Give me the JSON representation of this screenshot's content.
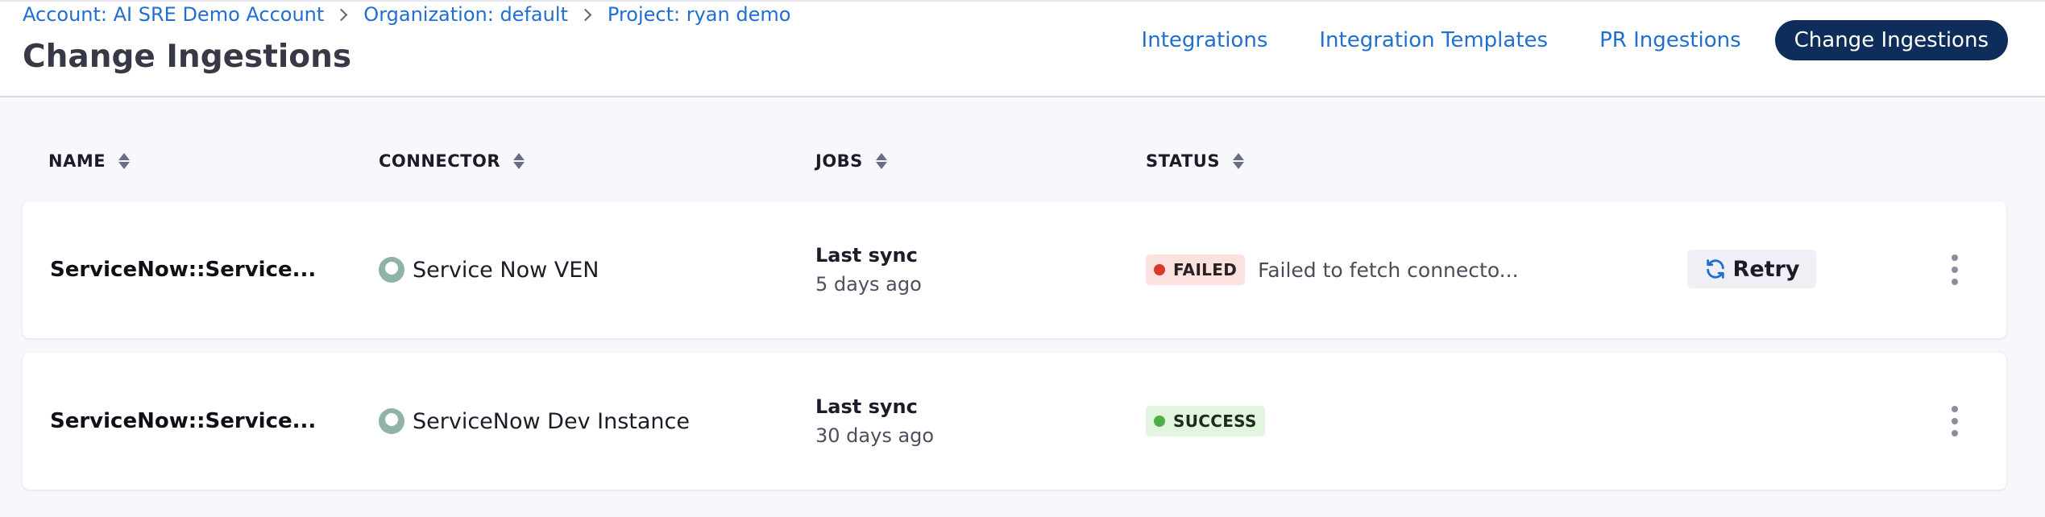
{
  "breadcrumb": [
    {
      "label": "Account: AI SRE Demo Account"
    },
    {
      "label": "Organization: default"
    },
    {
      "label": "Project: ryan demo"
    }
  ],
  "page_title": "Change Ingestions",
  "nav_tabs": [
    {
      "label": "Integrations",
      "active": false
    },
    {
      "label": "Integration Templates",
      "active": false
    },
    {
      "label": "PR Ingestions",
      "active": false
    },
    {
      "label": "Change Ingestions",
      "active": true
    }
  ],
  "table": {
    "columns": [
      "NAME",
      "CONNECTOR",
      "JOBS",
      "STATUS"
    ],
    "rows": [
      {
        "name": "ServiceNow::Service...",
        "connector": "Service Now VEN",
        "connector_icon": "connector-icon",
        "jobs_label": "Last sync",
        "jobs_time": "5 days ago",
        "status": "FAILED",
        "status_message": "Failed to fetch connecto...",
        "action_label": "Retry"
      },
      {
        "name": "ServiceNow::Service...",
        "connector": "ServiceNow Dev Instance",
        "connector_icon": "connector-icon",
        "jobs_label": "Last sync",
        "jobs_time": "30 days ago",
        "status": "SUCCESS",
        "status_message": "",
        "action_label": ""
      }
    ]
  },
  "colors": {
    "link": "#1f6fd1",
    "active_tab": "#0f2d5a",
    "failed": "#d9392b",
    "success": "#4fae45"
  }
}
